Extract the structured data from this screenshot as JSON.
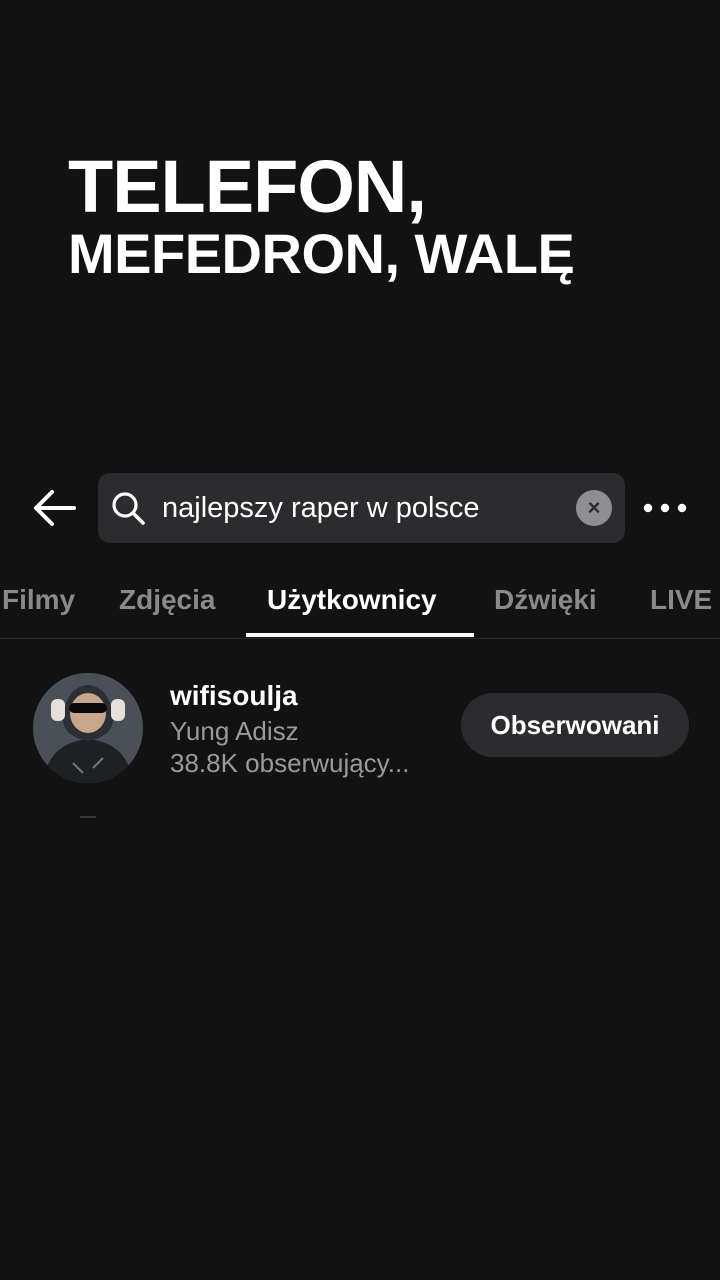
{
  "caption": {
    "line1": "TELEFON,",
    "line2": "MEFEDRON, WALĘ"
  },
  "search": {
    "query": "najlepszy raper w polsce",
    "clear_label": "×"
  },
  "tabs": [
    {
      "label": "Filmy"
    },
    {
      "label": "Zdjęcia"
    },
    {
      "label": "Użytkownicy"
    },
    {
      "label": "Dźwięki"
    },
    {
      "label": "LIVE"
    }
  ],
  "active_tab": "Użytkownicy",
  "result": {
    "username": "wifisoulja",
    "nickname": "Yung Adisz",
    "followers": "38.8K obserwujący...",
    "follow_label": "Obserwowani"
  },
  "icons": {
    "back": "back-arrow-icon",
    "search": "search-icon",
    "clear": "clear-icon",
    "more": "more-dots-icon"
  }
}
